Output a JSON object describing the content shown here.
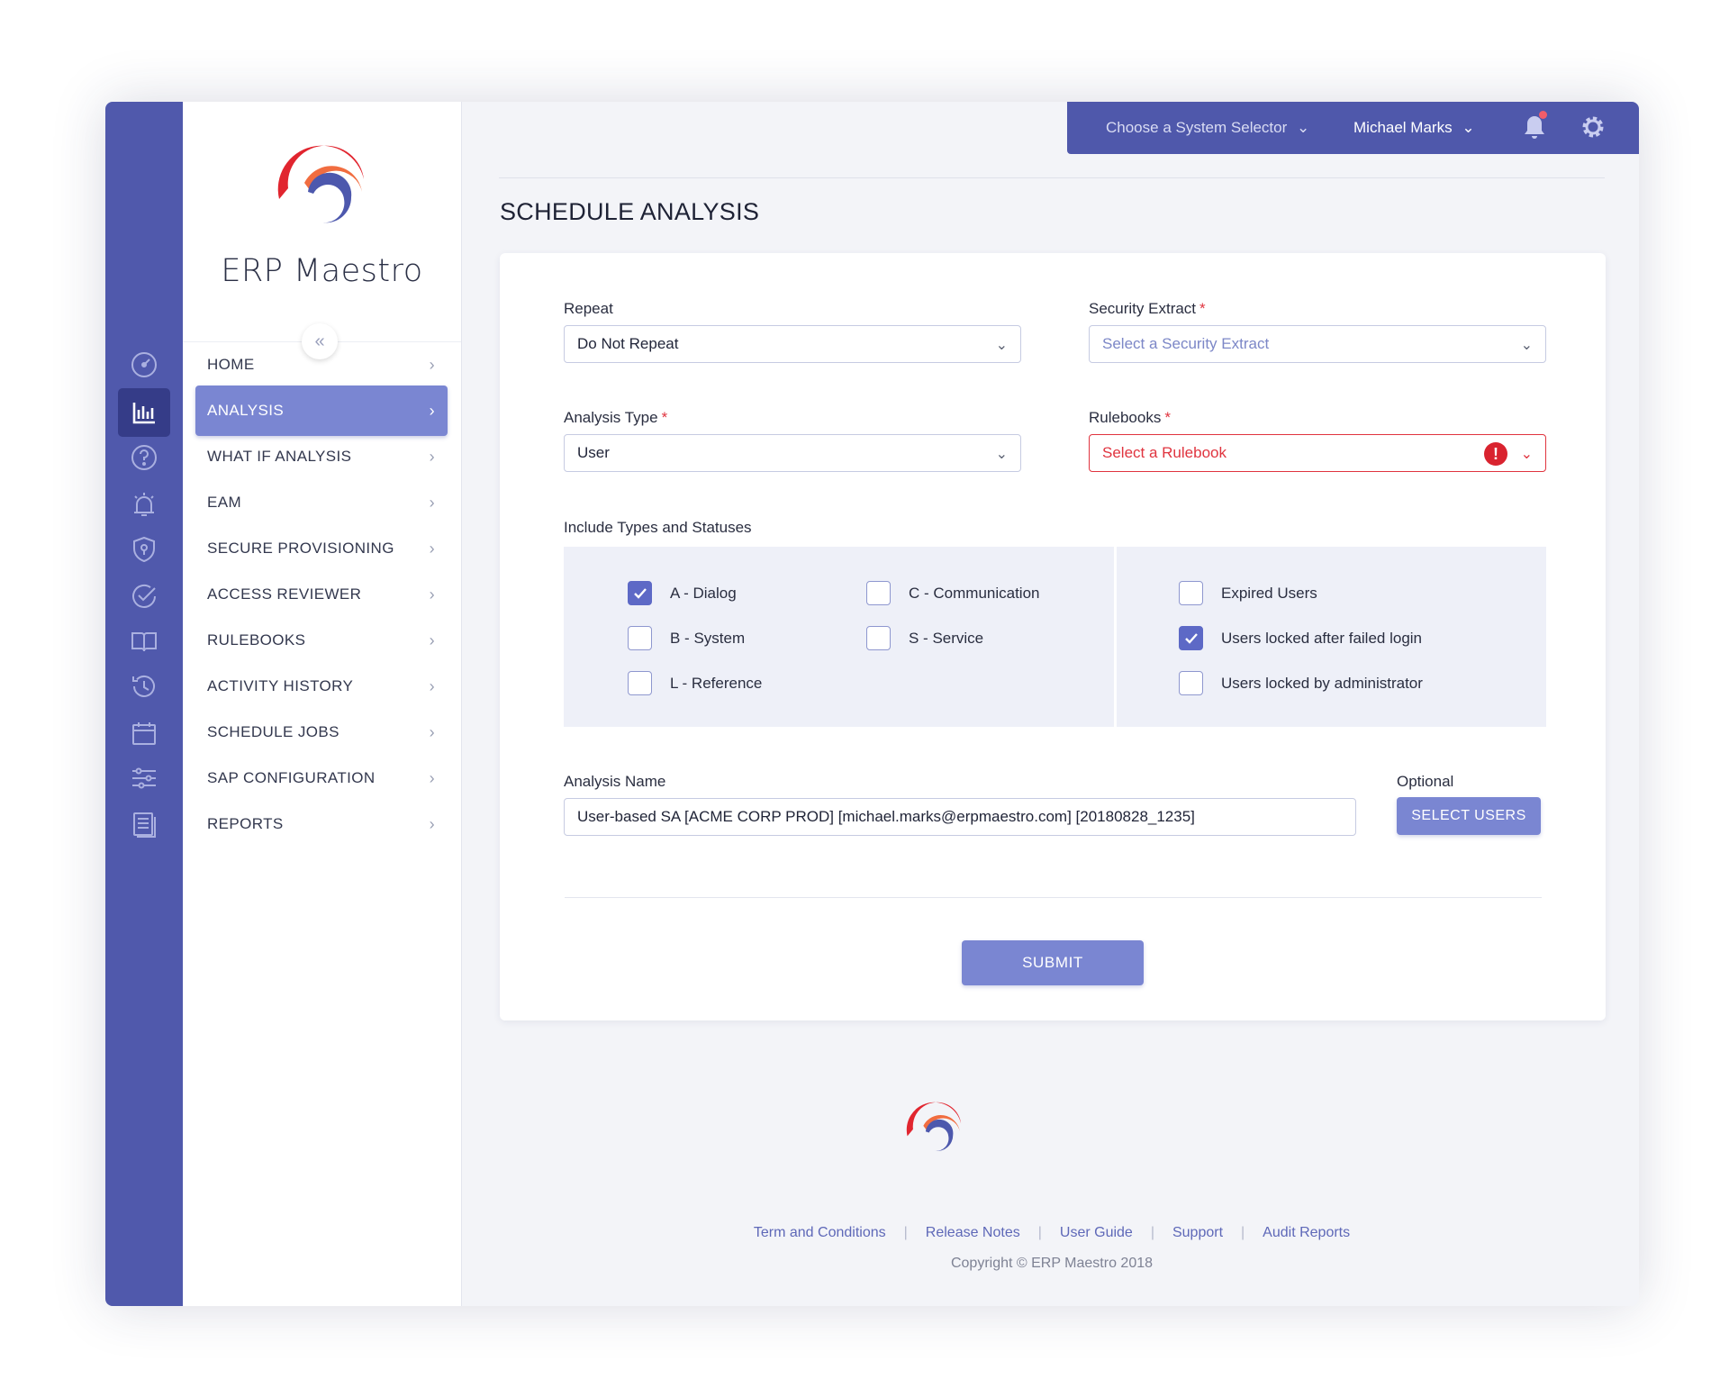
{
  "app": {
    "brand": "ERP Maestro"
  },
  "colors": {
    "rail": "#5059ac",
    "accent": "#7a86d2",
    "error": "#e0343f",
    "active_rail": "#353c88"
  },
  "rail_icons": [
    "speedometer-icon",
    "bar-chart-icon",
    "help-icon",
    "alarm-icon",
    "shield-icon",
    "check-circle-icon",
    "book-icon",
    "history-icon",
    "calendar-icon",
    "sliders-icon",
    "document-icon"
  ],
  "topbar": {
    "system_selector": "Choose a System Selector",
    "user": "Michael Marks"
  },
  "nav": [
    {
      "label": "HOME"
    },
    {
      "label": "ANALYSIS"
    },
    {
      "label": "WHAT IF ANALYSIS"
    },
    {
      "label": "EAM"
    },
    {
      "label": "SECURE PROVISIONING"
    },
    {
      "label": "ACCESS REVIEWER"
    },
    {
      "label": "RULEBOOKS"
    },
    {
      "label": "ACTIVITY HISTORY"
    },
    {
      "label": "SCHEDULE JOBS"
    },
    {
      "label": "SAP CONFIGURATION"
    },
    {
      "label": "REPORTS"
    }
  ],
  "page": {
    "title": "SCHEDULE ANALYSIS"
  },
  "form": {
    "repeat": {
      "label": "Repeat",
      "value": "Do Not Repeat"
    },
    "security_extract": {
      "label": "Security Extract",
      "placeholder": "Select a Security Extract"
    },
    "analysis_type": {
      "label": "Analysis Type",
      "value": "User"
    },
    "rulebooks": {
      "label": "Rulebooks",
      "placeholder": "Select a Rulebook"
    },
    "types_label": "Include Types and Statuses",
    "types": [
      {
        "label": "A - Dialog",
        "checked": true
      },
      {
        "label": "B - System",
        "checked": false
      },
      {
        "label": "L - Reference",
        "checked": false
      },
      {
        "label": "C - Communication",
        "checked": false
      },
      {
        "label": "S - Service",
        "checked": false
      }
    ],
    "statuses": [
      {
        "label": "Expired Users",
        "checked": false
      },
      {
        "label": "Users locked after failed login",
        "checked": true
      },
      {
        "label": "Users locked by administrator",
        "checked": false
      }
    ],
    "analysis_name": {
      "label": "Analysis Name",
      "value": "User-based SA [ACME CORP PROD] [michael.marks@erpmaestro.com] [20180828_1235]"
    },
    "optional_label": "Optional",
    "select_users": "SELECT USERS",
    "submit": "SUBMIT"
  },
  "footer": {
    "links": [
      "Term and Conditions",
      "Release Notes",
      "User Guide",
      "Support",
      "Audit Reports"
    ],
    "copyright": "Copyright © ERP Maestro 2018"
  }
}
